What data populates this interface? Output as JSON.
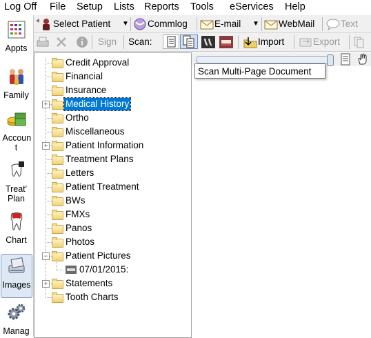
{
  "menu": [
    "Log Off",
    "File",
    "Setup",
    "Lists",
    "Reports",
    "Tools",
    "eServices",
    "Help"
  ],
  "modules": [
    {
      "label": "Appts",
      "icon": "calendar-icon"
    },
    {
      "label": "Family",
      "icon": "family-icon"
    },
    {
      "label": "Accoun t",
      "icon": "money-icon"
    },
    {
      "label": "Treat' Plan",
      "icon": "treatment-plan-icon"
    },
    {
      "label": "Chart",
      "icon": "tooth-icon"
    },
    {
      "label": "Images",
      "icon": "scanner-icon"
    },
    {
      "label": "Manag",
      "icon": "gears-icon"
    }
  ],
  "toolbar1": {
    "select_patient": "Select Patient",
    "commlog": "Commlog",
    "email": "E-mail",
    "webmail": "WebMail",
    "text": "Text"
  },
  "toolbar2": {
    "sign": "Sign",
    "scan": "Scan:",
    "import": "Import",
    "export": "Export"
  },
  "tree": [
    {
      "label": "Credit Approval",
      "expandable": false
    },
    {
      "label": "Financial",
      "expandable": false
    },
    {
      "label": "Insurance",
      "expandable": false
    },
    {
      "label": "Medical History",
      "expandable": true,
      "selected": true
    },
    {
      "label": "Ortho",
      "expandable": false
    },
    {
      "label": "Miscellaneous",
      "expandable": false
    },
    {
      "label": "Patient Information",
      "expandable": true
    },
    {
      "label": "Treatment Plans",
      "expandable": false
    },
    {
      "label": "Letters",
      "expandable": false
    },
    {
      "label": "Patient Treatment",
      "expandable": false
    },
    {
      "label": "BWs",
      "expandable": false
    },
    {
      "label": "FMXs",
      "expandable": false
    },
    {
      "label": "Panos",
      "expandable": false
    },
    {
      "label": "Photos",
      "expandable": false
    },
    {
      "label": "Patient Pictures",
      "expandable": true,
      "expanded": true
    },
    {
      "label": "07/01/2015:",
      "child": true
    },
    {
      "label": "Statements",
      "expandable": true
    },
    {
      "label": "Tooth Charts",
      "expandable": false
    }
  ],
  "tooltip": "Scan Multi-Page Document",
  "colors": {
    "selection": "#0078d7",
    "toolbar_bg": "#f0f0f0"
  }
}
